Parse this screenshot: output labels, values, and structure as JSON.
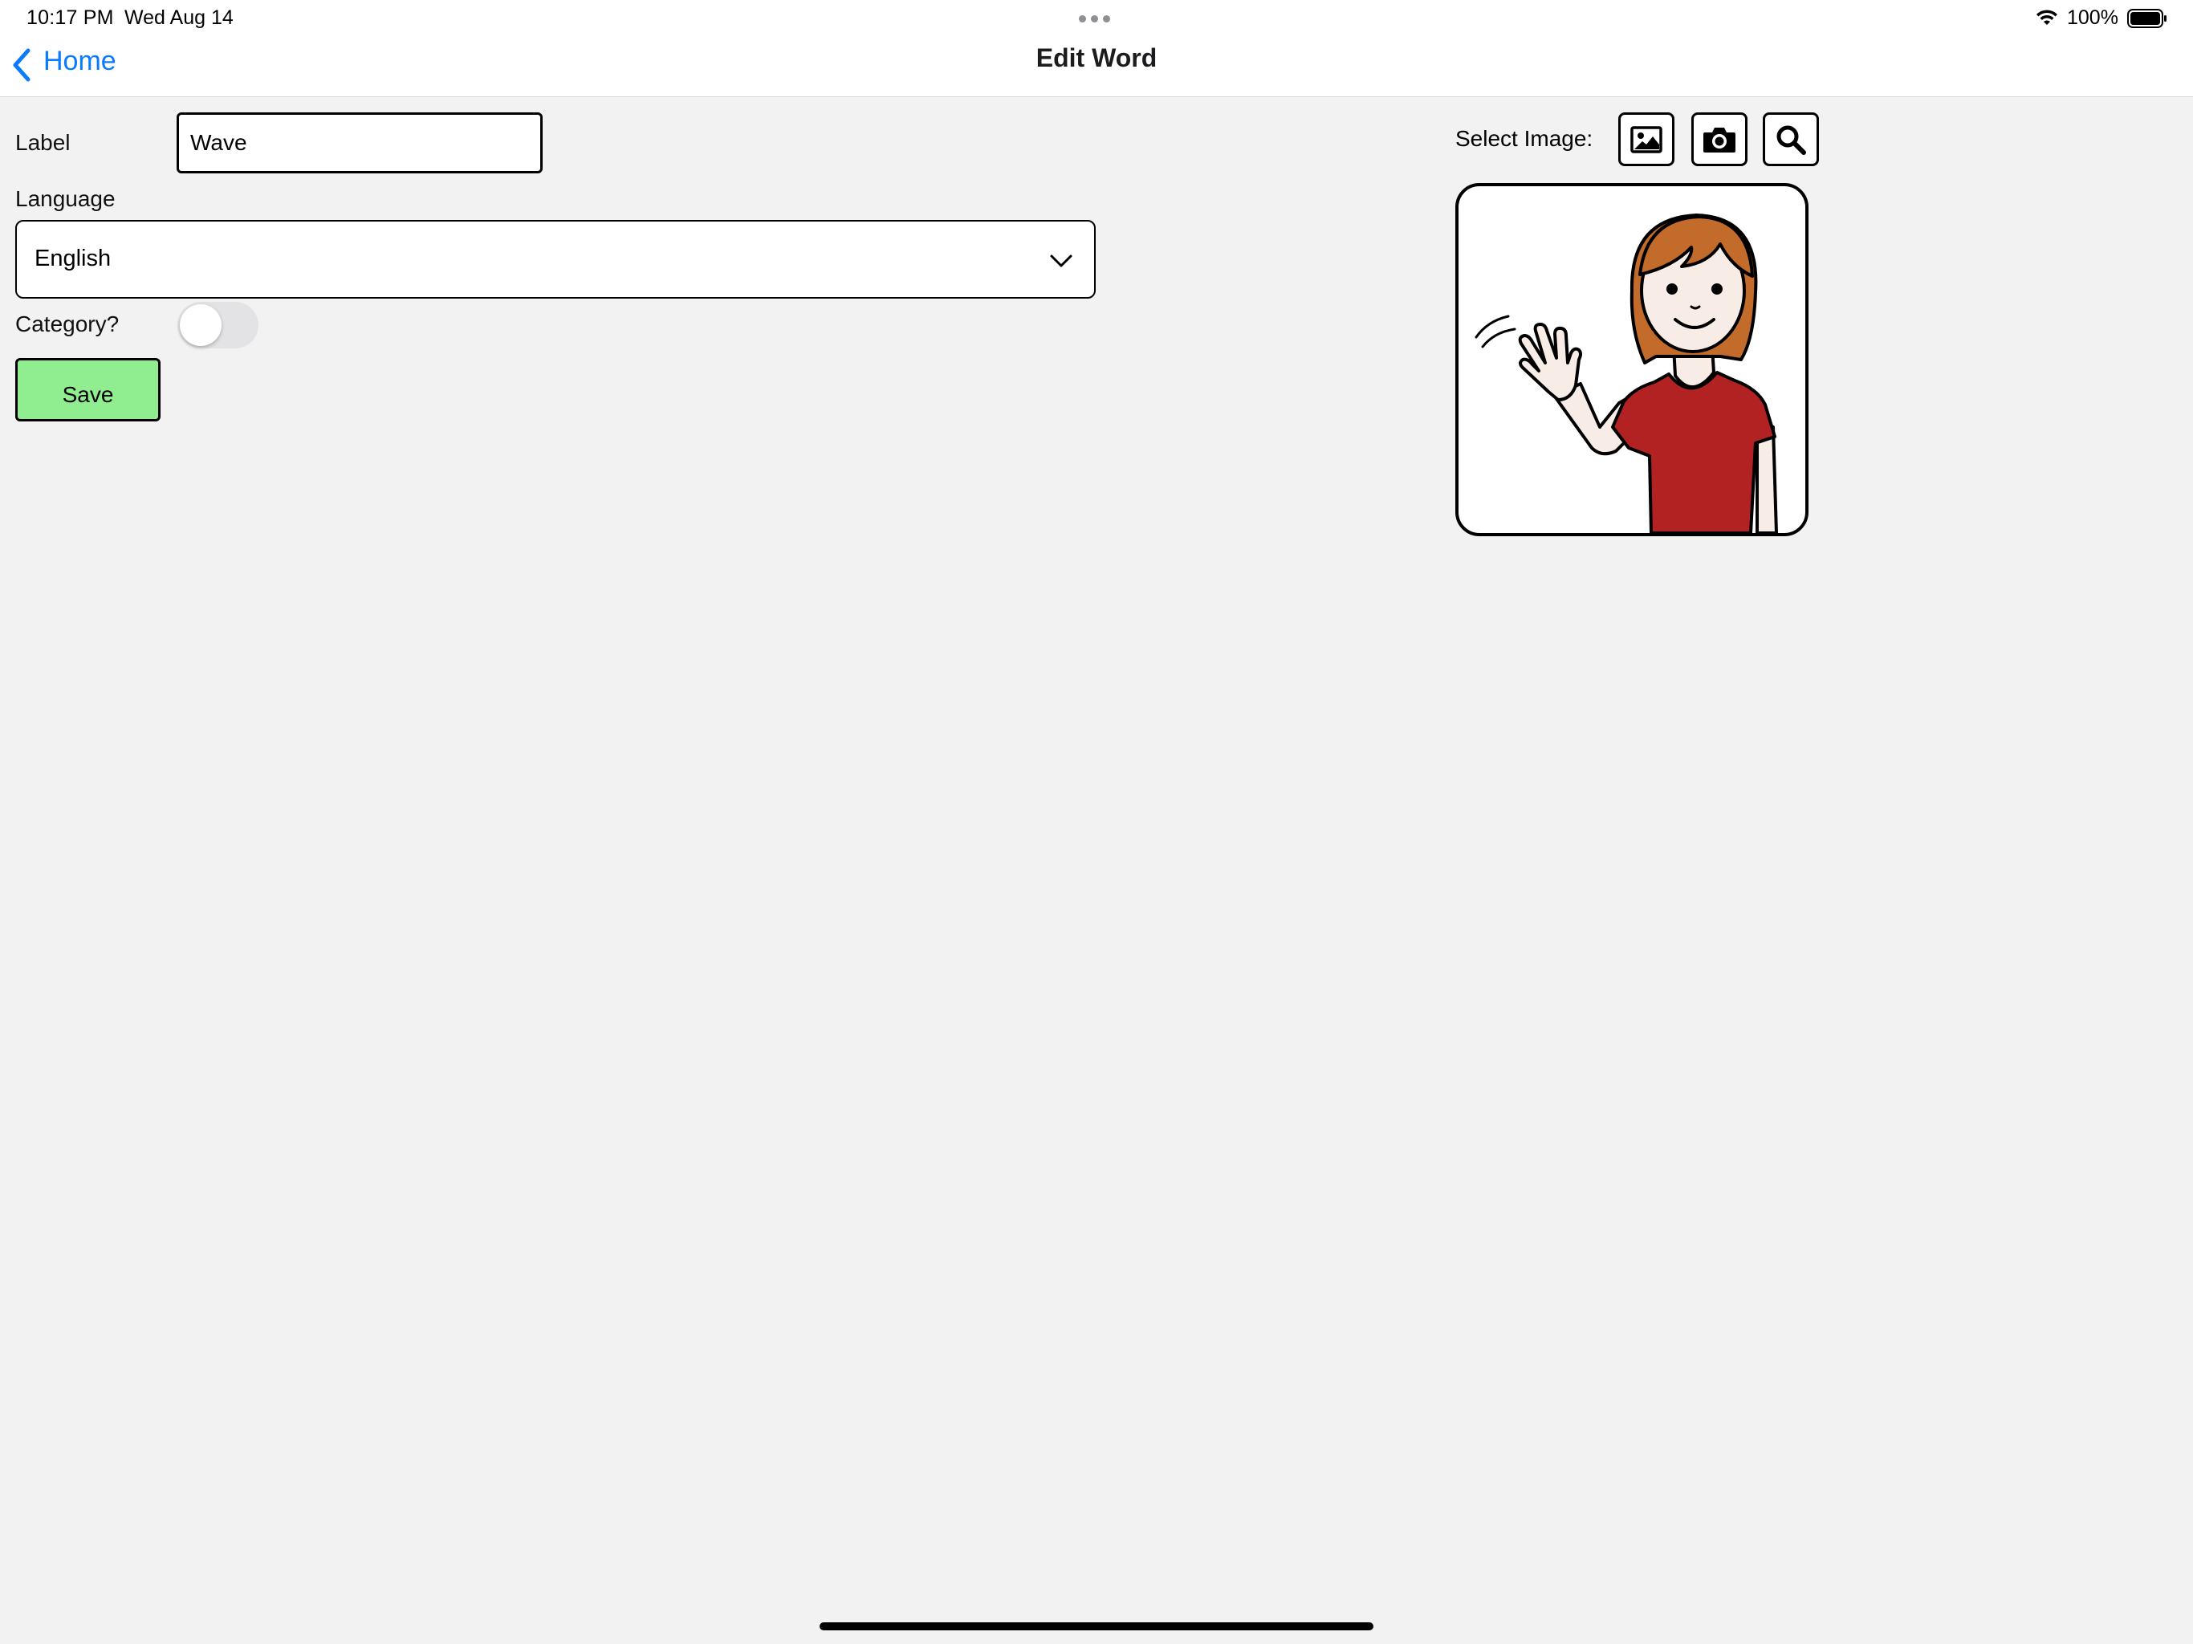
{
  "status_bar": {
    "time": "10:17 PM",
    "date": "Wed Aug 14",
    "battery": "100%",
    "icons": [
      "wifi-icon",
      "battery-icon",
      "multitask-dots-icon"
    ]
  },
  "nav": {
    "back_label": "Home",
    "title": "Edit Word",
    "accent_color": "#0a7aff"
  },
  "form": {
    "label_caption": "Label",
    "label_value": "Wave",
    "language_caption": "Language",
    "language_value": "English",
    "category_caption": "Category?",
    "category_on": false,
    "save_label": "Save",
    "save_color": "#90ee90"
  },
  "image_picker": {
    "caption": "Select Image:",
    "buttons": [
      "image-gallery-icon",
      "camera-icon",
      "search-icon"
    ],
    "selected_symbol": "person-waving-icon"
  }
}
